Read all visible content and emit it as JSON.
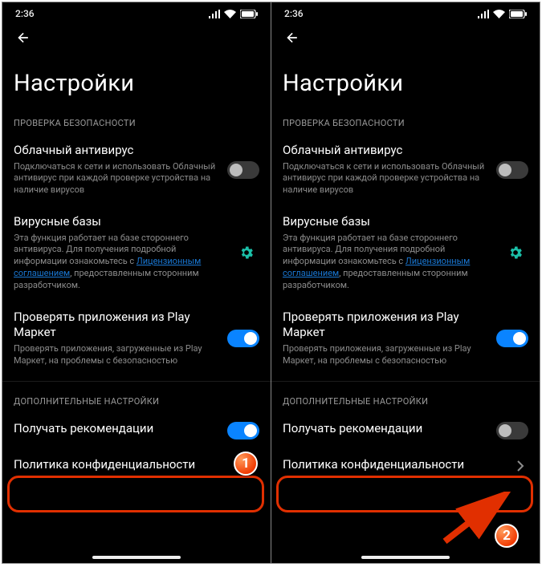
{
  "status": {
    "time": "2:36"
  },
  "header": {
    "title": "Настройки"
  },
  "sections": {
    "security_label": "ПРОВЕРКА БЕЗОПАСНОСТИ",
    "addl_label": "ДОПОЛНИТЕЛЬНЫЕ НАСТРОЙКИ"
  },
  "settings": {
    "cloud_av": {
      "title": "Облачный антивирус",
      "desc": "Подключаться к сети и использовать Облачный антивирус при каждой проверке устройства на наличие вирусов"
    },
    "db": {
      "title": "Вирусные базы",
      "desc_pre": "Эта функция работает на базе стороннего антивируса. Для получения подробной информации ознакомьтесь с ",
      "desc_link": "Лицензионным соглашением",
      "desc_post": ", предоставленным сторонним разработчиком."
    },
    "play": {
      "title": "Проверять приложения из Play Маркет",
      "desc": "Проверять приложения, загруженные из Play Маркет, на проблемы с безопасностью"
    },
    "rec": {
      "title": "Получать рекомендации"
    },
    "privacy": {
      "title": "Политика конфиденциальности"
    }
  },
  "badges": {
    "b1": "1",
    "b2": "2"
  }
}
